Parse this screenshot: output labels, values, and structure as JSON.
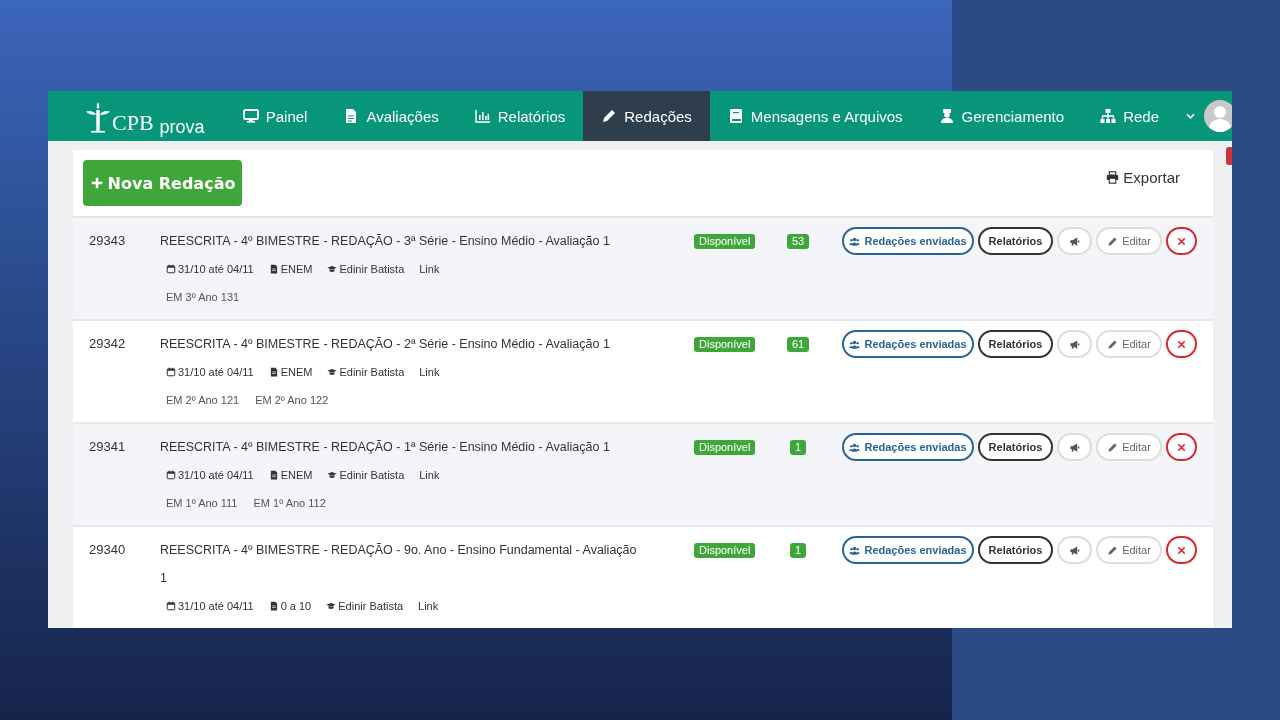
{
  "brand": {
    "name": "CPB",
    "product": "prova"
  },
  "nav": [
    {
      "label": "Painel",
      "kind": "dashboard",
      "selected": false
    },
    {
      "label": "Avaliações",
      "kind": "exams",
      "selected": false
    },
    {
      "label": "Relatórios",
      "kind": "reports",
      "selected": false
    },
    {
      "label": "Redações",
      "kind": "essays",
      "selected": true
    },
    {
      "label": "Mensagens e Arquivos",
      "kind": "messages",
      "selected": false
    },
    {
      "label": "Gerenciamento",
      "kind": "management",
      "selected": false
    },
    {
      "label": "Rede",
      "kind": "network",
      "selected": false
    }
  ],
  "toolbar": {
    "new_button": "Nova Redação",
    "export_button": "Exportar"
  },
  "rows": [
    {
      "id": "29343",
      "title": "REESCRITA - 4º BIMESTRE - REDAÇÃO - 3ª Série - Ensino Médio - Avaliação 1",
      "date": "31/10 até 04/11",
      "type": "ENEM",
      "teacher": "Edinir Batista",
      "link": "Link",
      "groups": [
        "EM 3º Ano 131"
      ],
      "status": "Disponível",
      "count": "53",
      "actions": [
        {
          "kind": "sent",
          "label": "Redações enviadas"
        },
        {
          "kind": "reports",
          "label": "Relatórios"
        },
        {
          "kind": "announce"
        },
        {
          "kind": "edit",
          "label": "Editar"
        },
        {
          "kind": "delete"
        }
      ]
    },
    {
      "id": "29342",
      "title": "REESCRITA - 4º BIMESTRE - REDAÇÃO - 2ª Série - Ensino Médio - Avaliação 1",
      "date": "31/10 até 04/11",
      "type": "ENEM",
      "teacher": "Edinir Batista",
      "link": "Link",
      "groups": [
        "EM 2º Ano 121",
        "EM 2º Ano 122"
      ],
      "status": "Disponível",
      "count": "61",
      "actions": [
        {
          "kind": "sent",
          "label": "Redações enviadas"
        },
        {
          "kind": "reports",
          "label": "Relatórios"
        },
        {
          "kind": "announce"
        },
        {
          "kind": "edit",
          "label": "Editar"
        },
        {
          "kind": "delete"
        }
      ]
    },
    {
      "id": "29341",
      "title": "REESCRITA - 4º BIMESTRE - REDAÇÃO - 1ª Série - Ensino Médio - Avaliação 1",
      "date": "31/10 até 04/11",
      "type": "ENEM",
      "teacher": "Edinir Batista",
      "link": "Link",
      "groups": [
        "EM 1º Ano 111",
        "EM 1º Ano 112"
      ],
      "status": "Disponível",
      "count": "1",
      "actions": [
        {
          "kind": "sent",
          "label": "Redações enviadas"
        },
        {
          "kind": "reports",
          "label": "Relatórios"
        },
        {
          "kind": "announce"
        },
        {
          "kind": "edit",
          "label": "Editar"
        },
        {
          "kind": "delete"
        }
      ]
    },
    {
      "id": "29340",
      "title": "REESCRITA - 4º BIMESTRE - REDAÇÃO - 9o. Ano - Ensino Fundamental - Avaliação 1",
      "date": "31/10 até 04/11",
      "type": "0 a 10",
      "teacher": "Edinir Batista",
      "link": "Link",
      "status": "Disponível",
      "count": "1",
      "actions": [
        {
          "kind": "sent",
          "label": "Redações enviadas"
        },
        {
          "kind": "reports",
          "label": "Relatórios"
        },
        {
          "kind": "announce"
        },
        {
          "kind": "edit",
          "label": "Editar"
        },
        {
          "kind": "delete"
        }
      ]
    }
  ]
}
